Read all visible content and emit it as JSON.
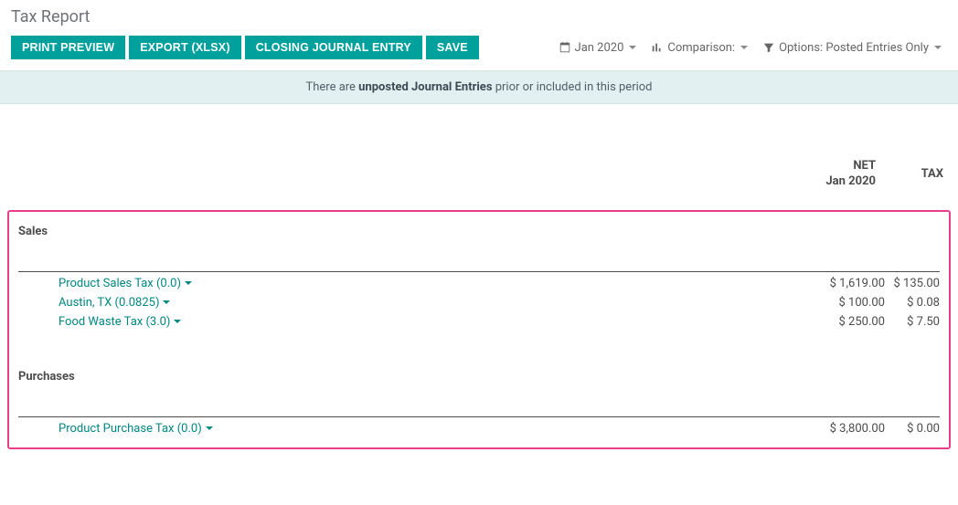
{
  "page_title": "Tax Report",
  "toolbar": {
    "print_preview": "PRINT PREVIEW",
    "export_xlsx": "EXPORT (XLSX)",
    "closing_journal_entry": "CLOSING JOURNAL ENTRY",
    "save": "SAVE"
  },
  "filters": {
    "date_label": "Jan 2020",
    "comparison_label": "Comparison:",
    "options_label": "Options: Posted Entries Only"
  },
  "info_bar": {
    "prefix": "There are ",
    "bold": "unposted Journal Entries",
    "suffix": " prior or included in this period"
  },
  "columns": {
    "net_label": "NET",
    "net_period": "Jan 2020",
    "tax_label": "TAX"
  },
  "sections": [
    {
      "title": "Sales",
      "rows": [
        {
          "label": "Product Sales Tax (0.0)",
          "net": "$ 1,619.00",
          "tax": "$ 135.00"
        },
        {
          "label": "Austin, TX (0.0825)",
          "net": "$ 100.00",
          "tax": "$ 0.08"
        },
        {
          "label": "Food Waste Tax (3.0)",
          "net": "$ 250.00",
          "tax": "$ 7.50"
        }
      ]
    },
    {
      "title": "Purchases",
      "rows": [
        {
          "label": "Product Purchase Tax (0.0)",
          "net": "$ 3,800.00",
          "tax": "$ 0.00"
        }
      ]
    }
  ]
}
